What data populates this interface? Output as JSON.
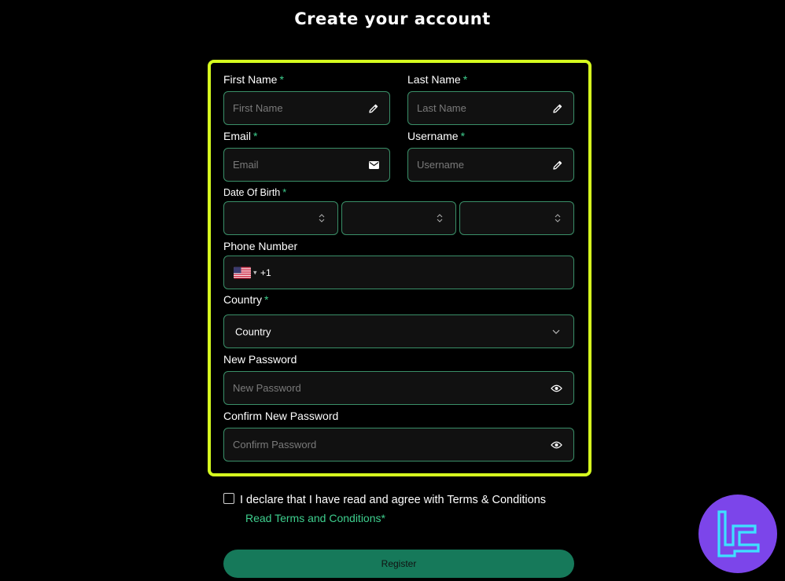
{
  "page": {
    "title": "Create your account"
  },
  "form": {
    "first_name": {
      "label": "First Name",
      "required": "*",
      "placeholder": "First Name"
    },
    "last_name": {
      "label": "Last Name",
      "required": "*",
      "placeholder": "Last Name"
    },
    "email": {
      "label": "Email",
      "required": "*",
      "placeholder": "Email"
    },
    "username": {
      "label": "Username",
      "required": "*",
      "placeholder": "Username"
    },
    "dob": {
      "label": "Date Of Birth",
      "required": "*"
    },
    "phone": {
      "label": "Phone Number",
      "code": "+1",
      "flag": "us-flag-icon"
    },
    "country": {
      "label": "Country",
      "required": "*",
      "selected": "Country"
    },
    "new_password": {
      "label": "New Password",
      "placeholder": "New Password"
    },
    "confirm_password": {
      "label": "Confirm New Password",
      "placeholder": "Confirm Password"
    }
  },
  "agreement": {
    "text": "I declare that I have read and agree with Terms & Conditions",
    "link": "Read Terms and Conditions*"
  },
  "register": {
    "label": "Register"
  },
  "colors": {
    "accent": "#d6ff1f",
    "green": "#3ecf8e",
    "button": "#16795a",
    "watermark": "#7c45ea"
  },
  "icons": [
    "pencil-icon",
    "envelope-icon",
    "eye-icon",
    "chevron-down-icon",
    "sort-arrows-icon",
    "us-flag-icon"
  ]
}
